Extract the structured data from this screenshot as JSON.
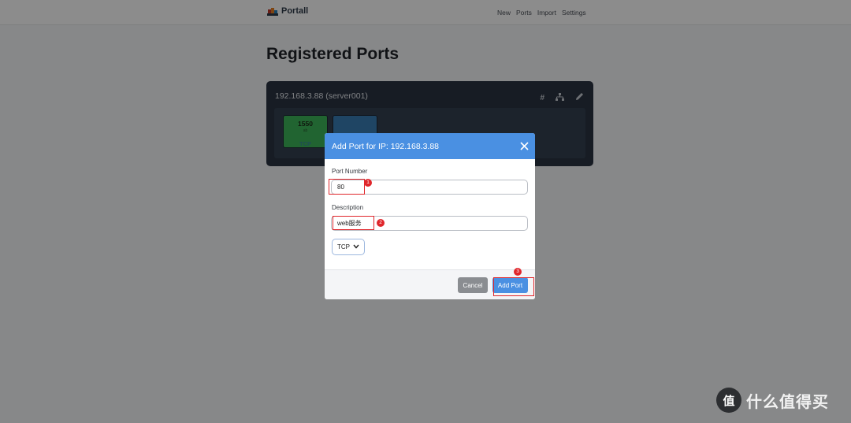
{
  "navbar": {
    "brand": "Portall",
    "links": [
      "New",
      "Ports",
      "Import",
      "Settings"
    ]
  },
  "page": {
    "title": "Registered Ports"
  },
  "host_card": {
    "title": "192.168.3.88 (server001)",
    "hash_symbol": "#",
    "ports": [
      {
        "number": "1550",
        "description": "ab",
        "protocol": "TCP"
      }
    ]
  },
  "modal": {
    "title": "Add Port for IP: 192.168.3.88",
    "port_number_label": "Port Number",
    "port_number_value": "80",
    "description_label": "Description",
    "description_value": "web服务",
    "protocol_value": "TCP",
    "cancel_label": "Cancel",
    "add_label": "Add Port"
  },
  "annotations": {
    "markers": [
      "1",
      "2",
      "3"
    ]
  },
  "watermark": {
    "badge": "值",
    "text": "什么值得买"
  },
  "colors": {
    "accent": "#4a90e2",
    "card_bg": "#2a3442",
    "tile_green": "#3cb65a",
    "tile_blue": "#3a7fb6",
    "annotation_red": "#e0262b"
  }
}
